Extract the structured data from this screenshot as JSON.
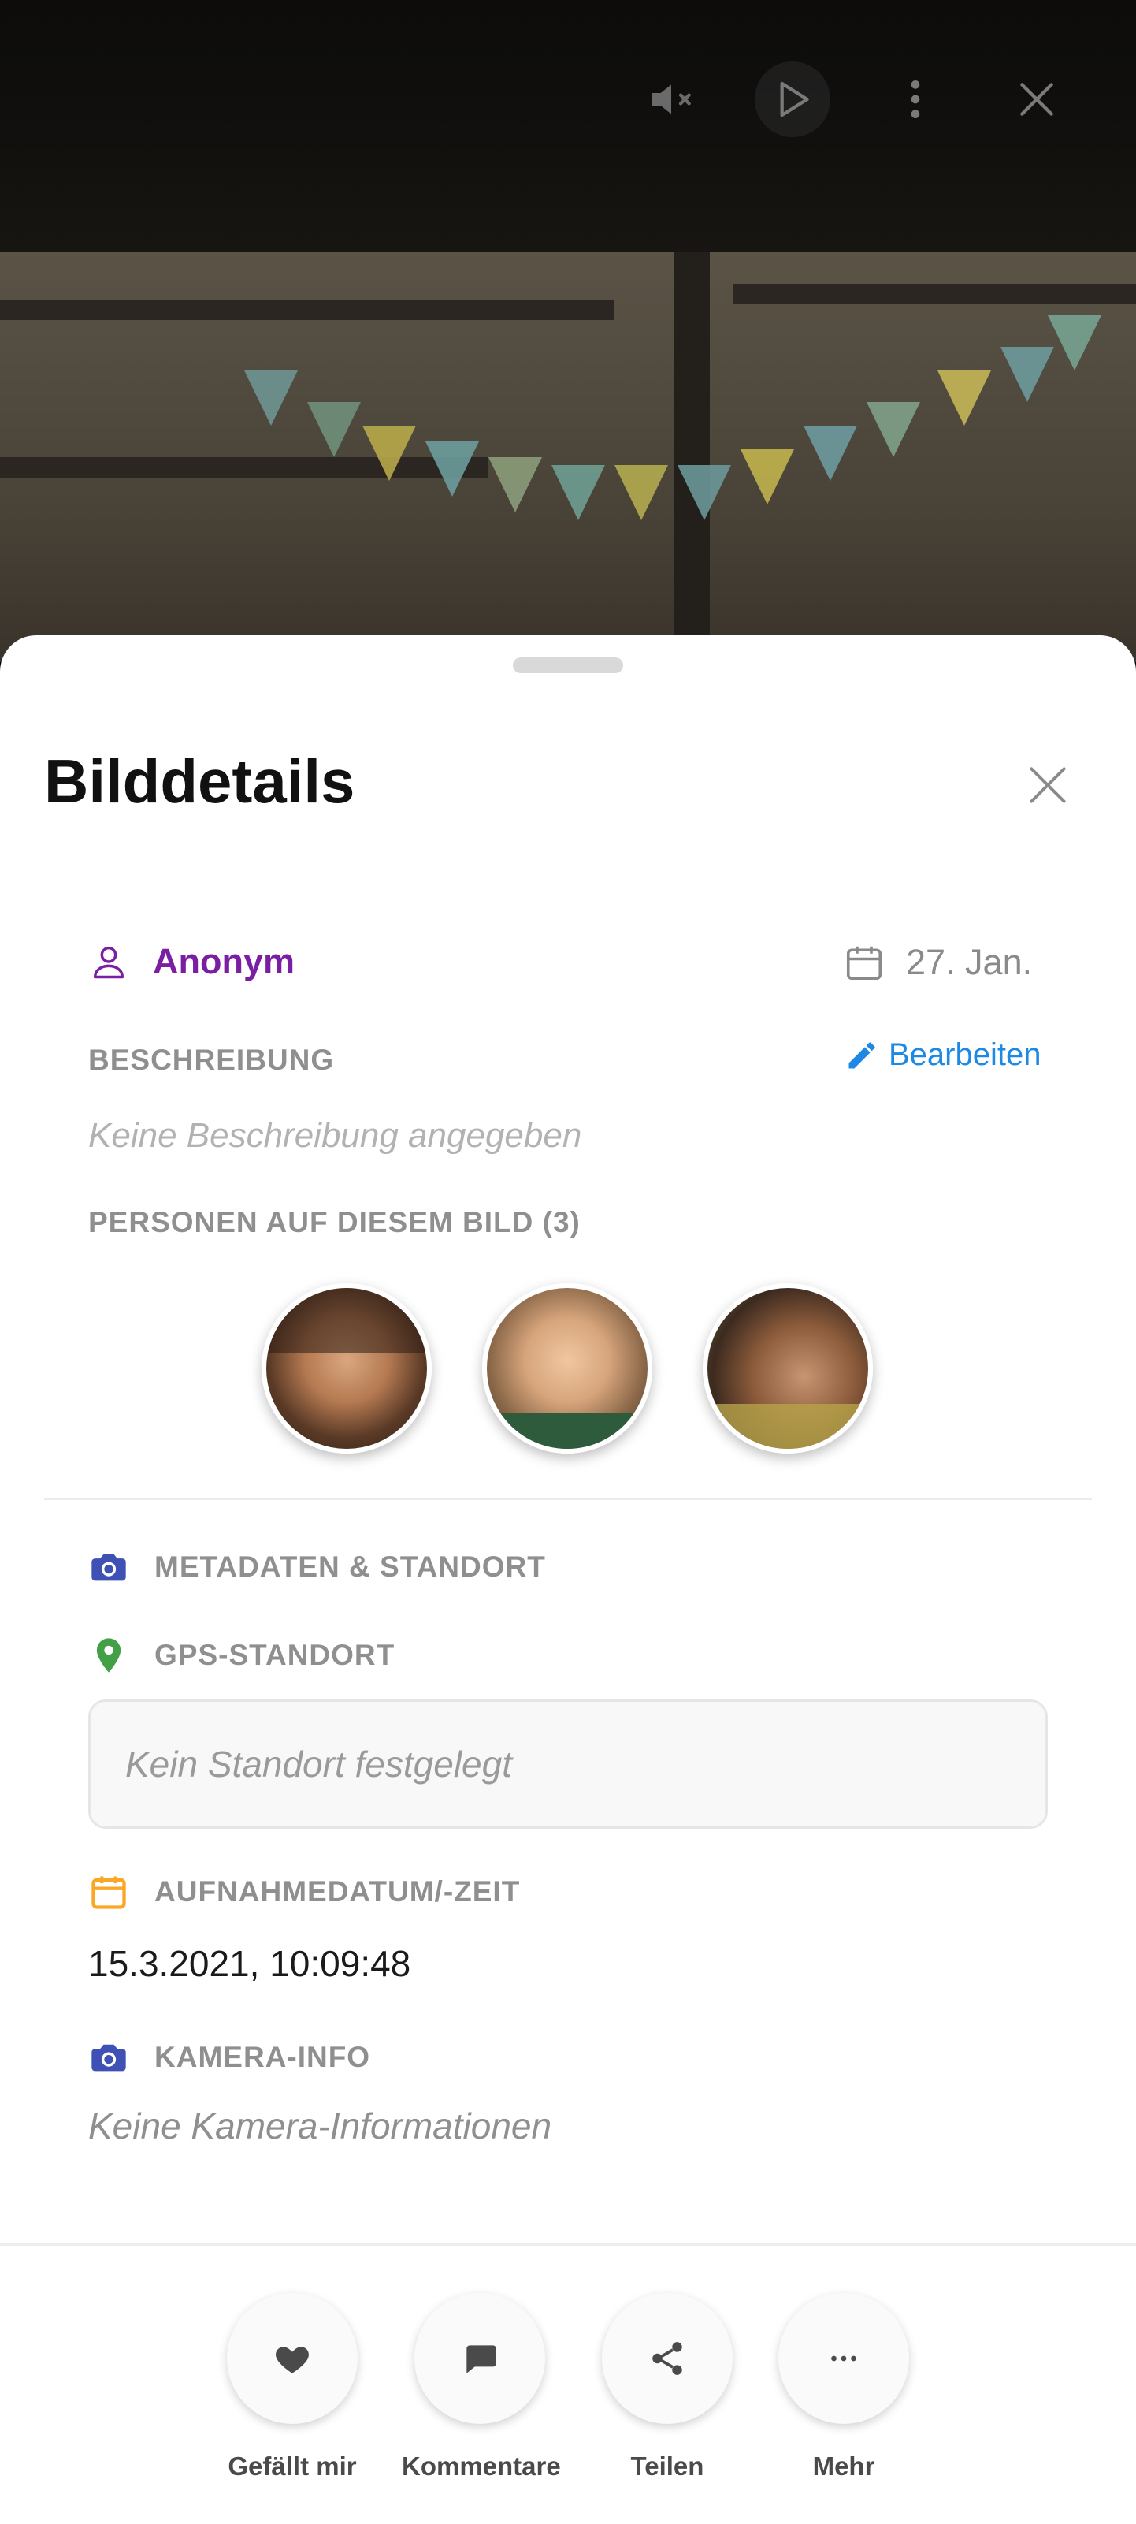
{
  "colors": {
    "accent_purple": "#7b1fa2",
    "link_blue": "#1e88e5",
    "metadata_icon": "#3f51b5",
    "gps_icon": "#43a047",
    "date_icon": "#f9a825"
  },
  "top_controls": {
    "mute_icon": "volume-mute-icon",
    "play_icon": "play-icon",
    "more_icon": "more-vertical-icon",
    "close_icon": "close-icon"
  },
  "sheet": {
    "title": "Bilddetails",
    "author": "Anonym",
    "date": "27. Jan.",
    "description_label": "BESCHREIBUNG",
    "edit_label": "Bearbeiten",
    "description_placeholder": "Keine Beschreibung angegeben",
    "people_label": "PERSONEN AUF DIESEM BILD (3)",
    "people_count": 3,
    "metadata_label": "METADATEN & STANDORT",
    "gps_label": "GPS-STANDORT",
    "gps_value": "Kein Standort festgelegt",
    "capture_label": "AUFNAHMEDATUM/-ZEIT",
    "capture_value": "15.3.2021, 10:09:48",
    "camera_label": "KAMERA-INFO",
    "camera_value": "Keine Kamera-Informationen"
  },
  "actions": [
    {
      "label": "Gefällt mir",
      "icon": "heart-icon"
    },
    {
      "label": "Kommentare",
      "icon": "comment-icon"
    },
    {
      "label": "Teilen",
      "icon": "share-icon"
    },
    {
      "label": "Mehr",
      "icon": "more-horizontal-icon"
    }
  ]
}
